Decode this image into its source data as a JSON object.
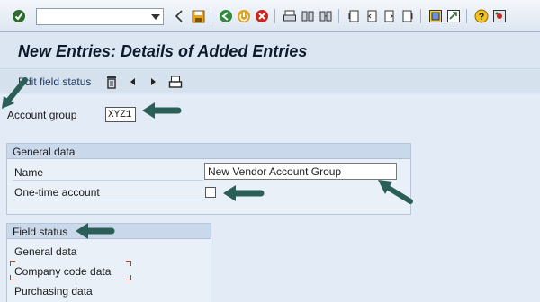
{
  "toolbar": {
    "command_field_value": "",
    "icons": [
      "enter-icon",
      "back-arrow-icon",
      "save-icon",
      "back-icon",
      "exit-icon",
      "cancel-icon",
      "print-icon",
      "find-icon",
      "find-next-icon",
      "first-page-icon",
      "prev-page-icon",
      "next-page-icon",
      "last-page-icon",
      "create-session-icon",
      "shortcut-icon",
      "help-icon",
      "customize-layout-icon"
    ]
  },
  "title": "New Entries: Details of Added Entries",
  "app_toolbar": {
    "edit_field_status_label": "Edit field status"
  },
  "account_group": {
    "label": "Account group",
    "value": "XYZ1"
  },
  "general_data": {
    "header": "General data",
    "name_label": "Name",
    "name_value": "New Vendor Account Group",
    "one_time_label": "One-time account",
    "one_time_checked": false
  },
  "field_status": {
    "header": "Field status",
    "items": [
      "General data",
      "Company code data",
      "Purchasing data"
    ]
  },
  "colors": {
    "annotation_arrow": "#2c5e58",
    "highlight_bracket": "#d03a1c"
  }
}
